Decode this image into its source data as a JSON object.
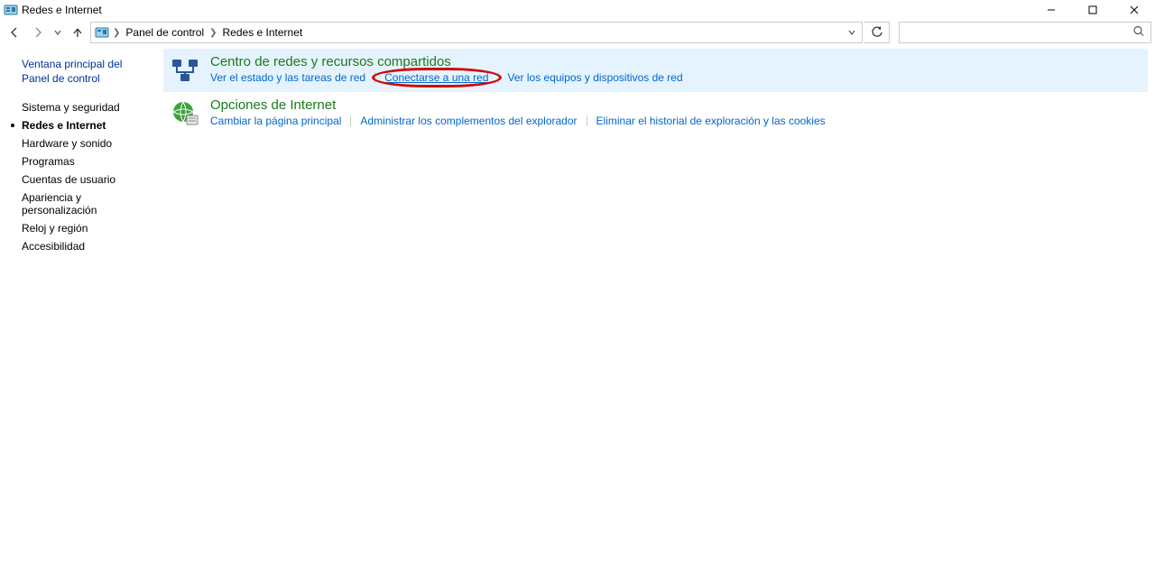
{
  "window": {
    "title": "Redes e Internet"
  },
  "breadcrumb": {
    "root": "Panel de control",
    "current": "Redes e Internet"
  },
  "sidebar": {
    "home": "Ventana principal del Panel de control",
    "items": [
      {
        "label": "Sistema y seguridad",
        "current": false
      },
      {
        "label": "Redes e Internet",
        "current": true
      },
      {
        "label": "Hardware y sonido",
        "current": false
      },
      {
        "label": "Programas",
        "current": false
      },
      {
        "label": "Cuentas de usuario",
        "current": false
      },
      {
        "label": "Apariencia y personalización",
        "current": false
      },
      {
        "label": "Reloj y región",
        "current": false
      },
      {
        "label": "Accesibilidad",
        "current": false
      }
    ]
  },
  "main": {
    "sections": [
      {
        "icon": "network-sharing-icon",
        "title": "Centro de redes y recursos compartidos",
        "highlight": true,
        "links": [
          "Ver el estado y las tareas de red",
          "Conectarse a una red",
          "Ver los equipos y dispositivos de red"
        ],
        "circled_link_index": 1
      },
      {
        "icon": "internet-options-icon",
        "title": "Opciones de Internet",
        "highlight": false,
        "links": [
          "Cambiar la página principal",
          "Administrar los complementos del explorador",
          "Eliminar el historial de exploración y las cookies"
        ]
      }
    ]
  }
}
